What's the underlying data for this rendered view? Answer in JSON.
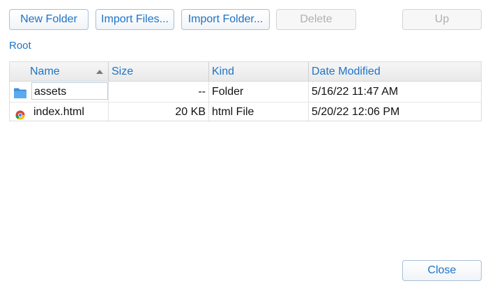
{
  "toolbar": {
    "new_folder": "New Folder",
    "import_files": "Import Files...",
    "import_folder": "Import Folder...",
    "delete": "Delete",
    "up": "Up"
  },
  "breadcrumb": {
    "root": "Root"
  },
  "table": {
    "columns": [
      "Name",
      "Size",
      "Kind",
      "Date Modified"
    ],
    "sort_column": "Name",
    "sort_direction": "ascending",
    "rows": [
      {
        "name": "assets",
        "size": "--",
        "kind": "Folder",
        "date_modified": "5/16/22 11:47 AM",
        "icon": "folder-icon"
      },
      {
        "name": "index.html",
        "size": "20 KB",
        "kind": "html File",
        "date_modified": "5/20/22 12:06 PM",
        "icon": "chrome-icon"
      }
    ]
  },
  "footer": {
    "close": "Close"
  },
  "colors": {
    "accent": "#1f73c6",
    "folder": "#4a9fe0",
    "disabled_text": "#b0b0b0"
  }
}
